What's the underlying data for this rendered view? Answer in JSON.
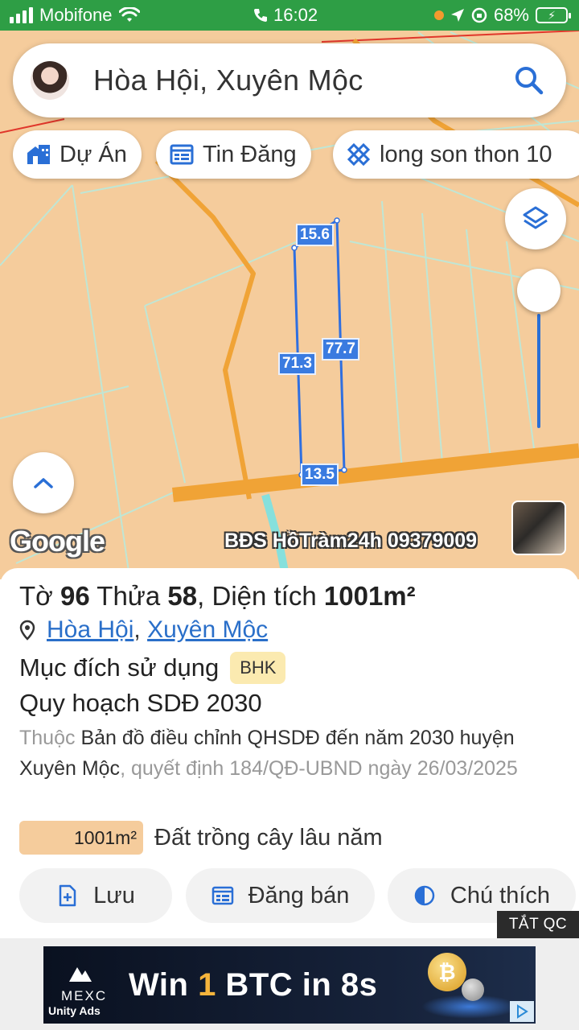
{
  "status_bar": {
    "carrier": "Mobifone",
    "time": "16:02",
    "battery": "68%"
  },
  "search": {
    "query": "Hòa Hội, Xuyên Mộc"
  },
  "chips": [
    {
      "label": "Dự Án",
      "icon": "building-icon"
    },
    {
      "label": "Tin Đăng",
      "icon": "listing-icon"
    },
    {
      "label": "long son thon 10",
      "icon": "ruler-icon"
    }
  ],
  "map": {
    "dimensions": {
      "top": "15.6",
      "left": "71.3",
      "right": "77.7",
      "bottom": "13.5"
    },
    "google_label": "Google",
    "watermark": "BĐS HồTràm24h 09379009"
  },
  "parcel": {
    "to_label": "Tờ",
    "to_value": "96",
    "thua_label": "Thửa",
    "thua_value": "58",
    "area_label": "Diện tích",
    "area_value": "1001m²",
    "location_parts": [
      "Hòa Hội",
      "Xuyên Mộc"
    ],
    "purpose_label": "Mục đích sử dụng",
    "purpose_code": "BHK",
    "plan_title": "Quy hoạch SDĐ 2030",
    "desc_prefix": "Thuộc",
    "desc_main": "Bản đồ điều chỉnh QHSDĐ đến năm 2030 huyện Xuyên Mộc",
    "desc_suffix": ", quyết định 184/QĐ-UBND ngày 26/03/2025",
    "land_area": "1001m²",
    "land_type": "Đất trồng cây lâu năm",
    "land_color": "#f5cc9c"
  },
  "actions": {
    "save": "Lưu",
    "post": "Đăng bán",
    "legend": "Chú thích"
  },
  "ad": {
    "close_label": "TẮT QC",
    "brand": "MEXC",
    "network": "Unity Ads",
    "headline_a": "Win ",
    "headline_num": "1",
    "headline_b": " BTC in 8s",
    "coin_symbol": "₿"
  }
}
